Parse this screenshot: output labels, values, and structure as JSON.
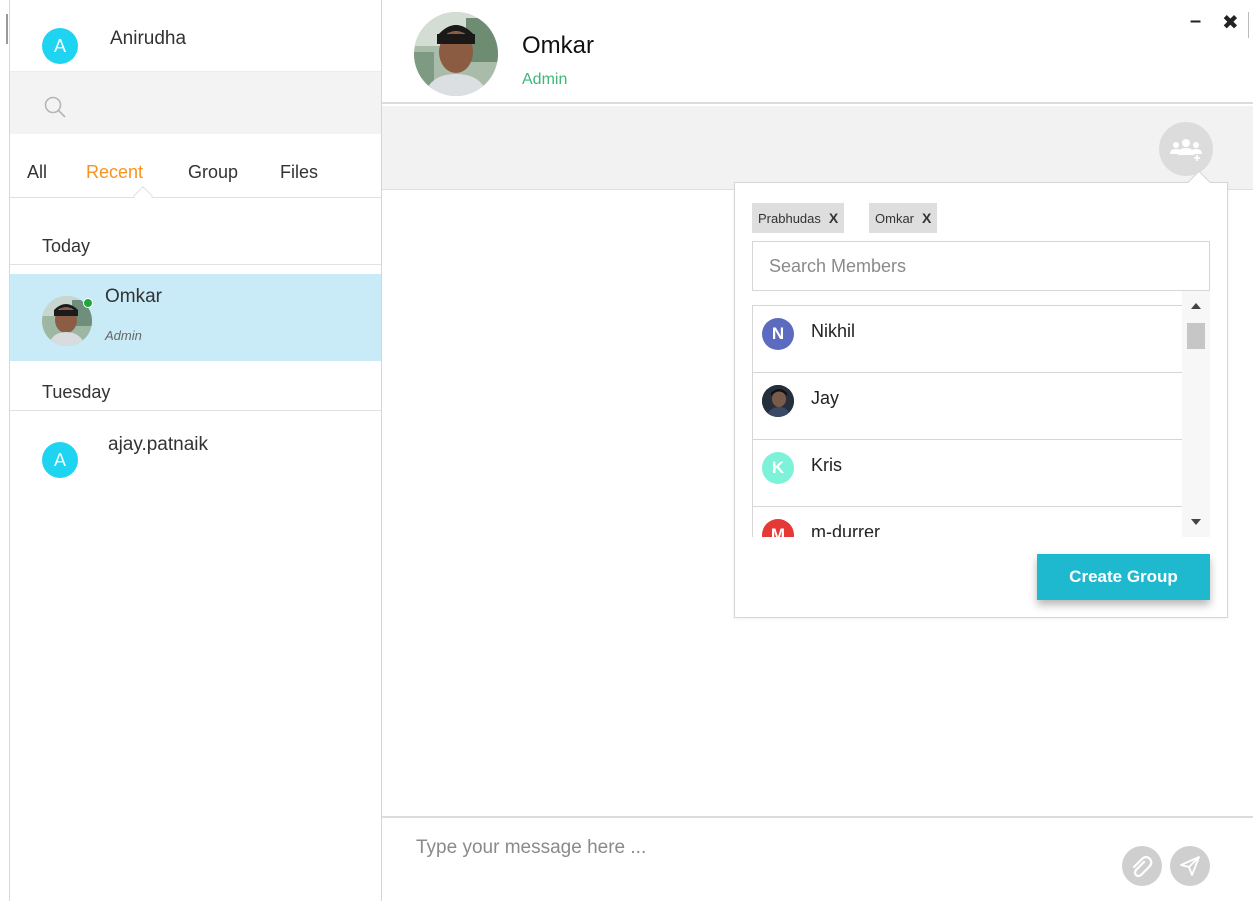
{
  "user": {
    "name": "Anirudha",
    "initial": "A",
    "avatar_color": "#1ed4f1"
  },
  "search": {
    "icon": "search-icon"
  },
  "tabs": [
    {
      "label": "All"
    },
    {
      "label": "Recent",
      "active": true
    },
    {
      "label": "Group"
    },
    {
      "label": "Files"
    }
  ],
  "sections": {
    "today": "Today",
    "tuesday": "Tuesday"
  },
  "chats": [
    {
      "name": "Omkar",
      "subtitle": "Admin",
      "status": "online",
      "selected": true
    },
    {
      "name": "ajay.patnaik",
      "initial": "A"
    }
  ],
  "header": {
    "name": "Omkar",
    "role": "Admin",
    "minimize": "–",
    "close": "✖"
  },
  "group_popup": {
    "chips": [
      {
        "label": "Prabhudas",
        "remove": "X"
      },
      {
        "label": "Omkar",
        "remove": "X"
      }
    ],
    "search_placeholder": "Search Members",
    "members": [
      {
        "name": "Nikhil",
        "initial": "N",
        "color": "#5c6bc0"
      },
      {
        "name": "Jay",
        "initial": "",
        "color": "#2b2f3a"
      },
      {
        "name": "Kris",
        "initial": "K",
        "color": "#7ef2d8"
      },
      {
        "name": "m-durrer",
        "initial": "M",
        "color": "#e53935"
      }
    ],
    "create_label": "Create Group"
  },
  "composer": {
    "placeholder": "Type your message here ..."
  },
  "colors": {
    "accent": "#f7931e",
    "selected_row": "#c9ebf8",
    "online": "#1ea73c",
    "role_green": "#3cb878",
    "button": "#1fb9cf"
  }
}
